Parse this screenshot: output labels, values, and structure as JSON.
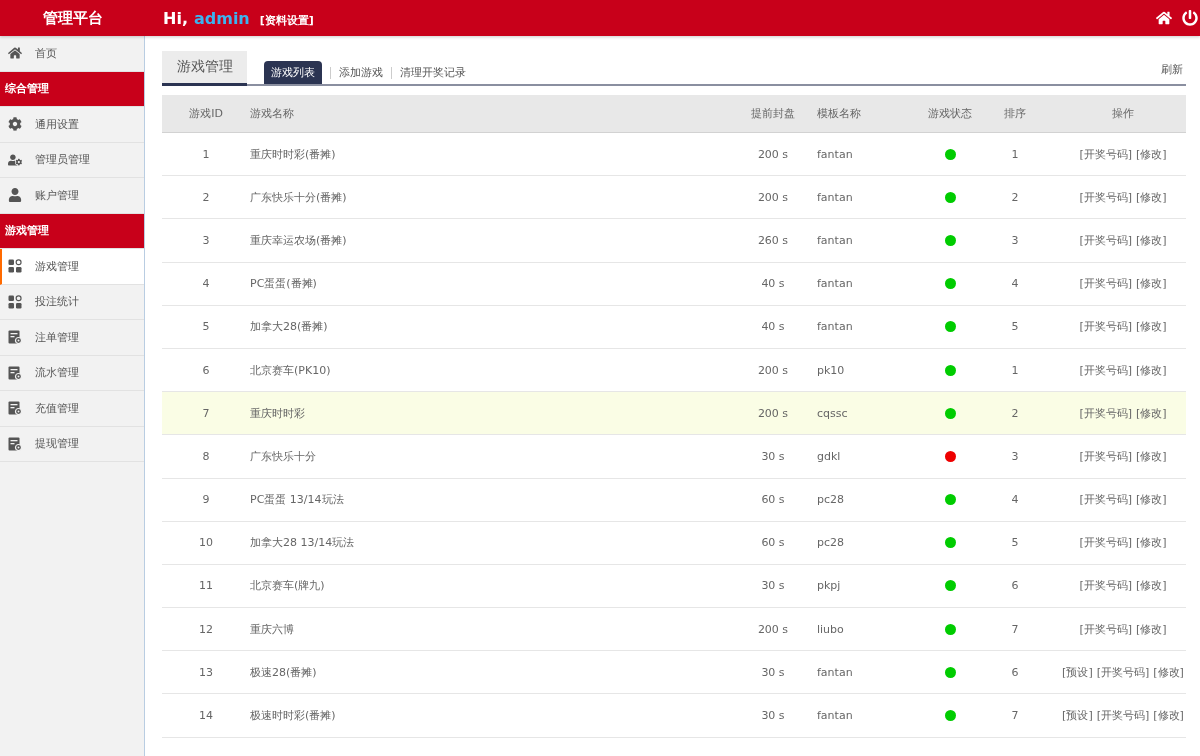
{
  "header": {
    "brand": "管理平台",
    "greeting": "Hi,",
    "username": "admin",
    "profile_link": "[资料设置]"
  },
  "sidebar": {
    "items": [
      {
        "kind": "link",
        "label": "首页",
        "selected": false
      },
      {
        "kind": "section",
        "label": "综合管理"
      },
      {
        "kind": "link",
        "label": "通用设置",
        "selected": false
      },
      {
        "kind": "link",
        "label": "管理员管理",
        "selected": false
      },
      {
        "kind": "link",
        "label": "账户管理",
        "selected": false
      },
      {
        "kind": "section",
        "label": "游戏管理"
      },
      {
        "kind": "link",
        "label": "游戏管理",
        "selected": true
      },
      {
        "kind": "link",
        "label": "投注统计",
        "selected": false
      },
      {
        "kind": "link",
        "label": "注单管理",
        "selected": false
      },
      {
        "kind": "link",
        "label": "流水管理",
        "selected": false
      },
      {
        "kind": "link",
        "label": "充值管理",
        "selected": false
      },
      {
        "kind": "link",
        "label": "提现管理",
        "selected": false
      }
    ]
  },
  "content": {
    "page_title": "游戏管理",
    "tabs": [
      {
        "label": "游戏列表",
        "selected": true
      },
      {
        "label": "添加游戏",
        "selected": false
      },
      {
        "label": "清理开奖记录",
        "selected": false
      }
    ],
    "refresh": "刷新",
    "table": {
      "columns": [
        "游戏ID",
        "游戏名称",
        "提前封盘",
        "模板名称",
        "游戏状态",
        "排序",
        "操作"
      ],
      "rows": [
        {
          "id": "1",
          "name": "重庆时时彩(番摊)",
          "close_time": "200 s",
          "template": "fantan",
          "enabled": true,
          "sort": "1",
          "actions": [
            "[开奖号码]",
            "[修改]"
          ],
          "highlighted": false
        },
        {
          "id": "2",
          "name": "广东快乐十分(番摊)",
          "close_time": "200 s",
          "template": "fantan",
          "enabled": true,
          "sort": "2",
          "actions": [
            "[开奖号码]",
            "[修改]"
          ],
          "highlighted": false
        },
        {
          "id": "3",
          "name": "重庆幸运农场(番摊)",
          "close_time": "260 s",
          "template": "fantan",
          "enabled": true,
          "sort": "3",
          "actions": [
            "[开奖号码]",
            "[修改]"
          ],
          "highlighted": false
        },
        {
          "id": "4",
          "name": "PC蛋蛋(番摊)",
          "close_time": "40 s",
          "template": "fantan",
          "enabled": true,
          "sort": "4",
          "actions": [
            "[开奖号码]",
            "[修改]"
          ],
          "highlighted": false
        },
        {
          "id": "5",
          "name": "加拿大28(番摊)",
          "close_time": "40 s",
          "template": "fantan",
          "enabled": true,
          "sort": "5",
          "actions": [
            "[开奖号码]",
            "[修改]"
          ],
          "highlighted": false
        },
        {
          "id": "6",
          "name": "北京赛车(PK10)",
          "close_time": "200 s",
          "template": "pk10",
          "enabled": true,
          "sort": "1",
          "actions": [
            "[开奖号码]",
            "[修改]"
          ],
          "highlighted": false
        },
        {
          "id": "7",
          "name": "重庆时时彩",
          "close_time": "200 s",
          "template": "cqssc",
          "enabled": true,
          "sort": "2",
          "actions": [
            "[开奖号码]",
            "[修改]"
          ],
          "highlighted": true
        },
        {
          "id": "8",
          "name": "广东快乐十分",
          "close_time": "30 s",
          "template": "gdkl",
          "enabled": false,
          "sort": "3",
          "actions": [
            "[开奖号码]",
            "[修改]"
          ],
          "highlighted": false
        },
        {
          "id": "9",
          "name": "PC蛋蛋 13/14玩法",
          "close_time": "60 s",
          "template": "pc28",
          "enabled": true,
          "sort": "4",
          "actions": [
            "[开奖号码]",
            "[修改]"
          ],
          "highlighted": false
        },
        {
          "id": "10",
          "name": "加拿大28 13/14玩法",
          "close_time": "60 s",
          "template": "pc28",
          "enabled": true,
          "sort": "5",
          "actions": [
            "[开奖号码]",
            "[修改]"
          ],
          "highlighted": false
        },
        {
          "id": "11",
          "name": "北京赛车(牌九)",
          "close_time": "30 s",
          "template": "pkpj",
          "enabled": true,
          "sort": "6",
          "actions": [
            "[开奖号码]",
            "[修改]"
          ],
          "highlighted": false
        },
        {
          "id": "12",
          "name": "重庆六博",
          "close_time": "200 s",
          "template": "liubo",
          "enabled": true,
          "sort": "7",
          "actions": [
            "[开奖号码]",
            "[修改]"
          ],
          "highlighted": false
        },
        {
          "id": "13",
          "name": "极速28(番摊)",
          "close_time": "30 s",
          "template": "fantan",
          "enabled": true,
          "sort": "6",
          "actions": [
            "[预设]",
            "[开奖号码]",
            "[修改]"
          ],
          "highlighted": false
        },
        {
          "id": "14",
          "name": "极速时时彩(番摊)",
          "close_time": "30 s",
          "template": "fantan",
          "enabled": true,
          "sort": "7",
          "actions": [
            "[预设]",
            "[开奖号码]",
            "[修改]"
          ],
          "highlighted": false
        }
      ]
    }
  }
}
